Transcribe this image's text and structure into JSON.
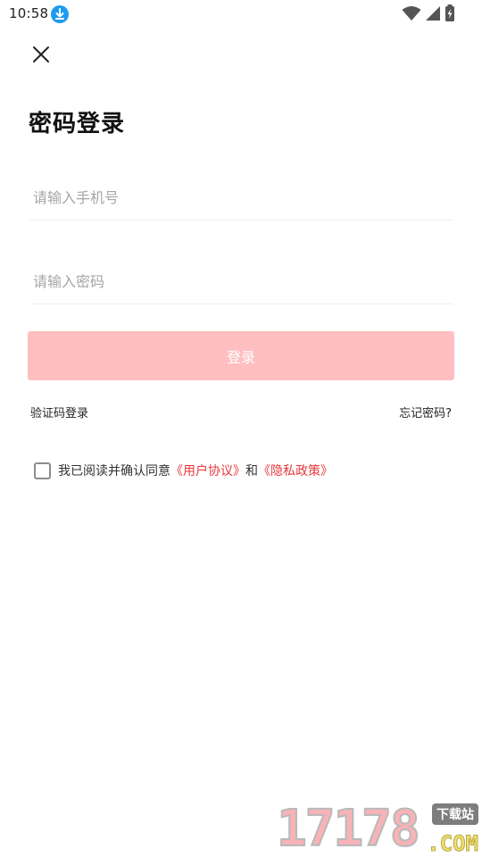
{
  "status_bar": {
    "time": "10:58",
    "icons": [
      "download-icon",
      "wifi-icon",
      "cell-signal-icon",
      "battery-charging-icon"
    ]
  },
  "header": {
    "close_icon": "close-icon",
    "title": "密码登录"
  },
  "form": {
    "phone_placeholder": "请输入手机号",
    "phone_value": "",
    "password_placeholder": "请输入密码",
    "password_value": "",
    "login_label": "登录",
    "sms_login_label": "验证码登录",
    "forgot_password_label": "忘记密码?"
  },
  "agreement": {
    "checked": false,
    "text_before": "我已阅读并确认同意",
    "user_agreement": "《用户协议》",
    "conjunction": "和",
    "privacy_policy": "《隐私政策》"
  },
  "watermark": {
    "digits": "17178",
    "badge": "下载站",
    "domain": ".COM"
  },
  "colors": {
    "accent_disabled": "#ffbec0",
    "link": "#e8383d",
    "download_icon": "#1e9bf0"
  }
}
